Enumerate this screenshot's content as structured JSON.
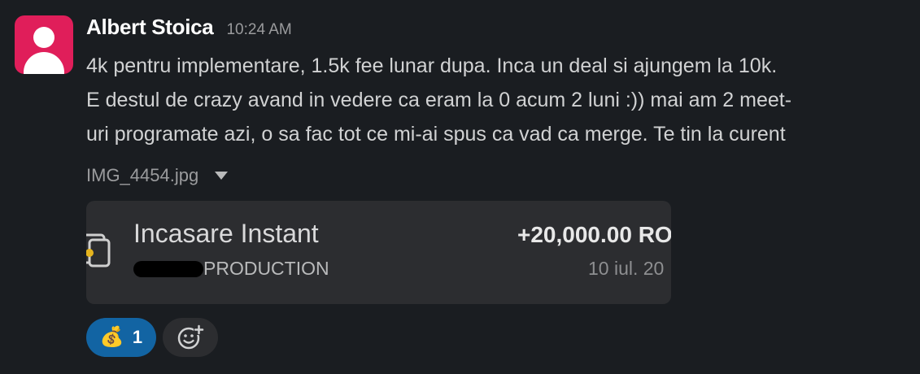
{
  "message": {
    "author": "Albert Stoica",
    "time": "10:24 AM",
    "lines": [
      "4k pentru implementare, 1.5k fee lunar dupa. Inca un deal si ajungem la 10k.",
      "E destul de crazy avand in vedere ca eram la 0 acum 2 luni :)) mai am 2 meet-",
      "uri programate azi, o sa fac tot ce mi-ai spus ca vad ca merge. Te tin la curent"
    ]
  },
  "attachment": {
    "file_name": "IMG_4454.jpg",
    "title": "Incasare Instant",
    "subtitle": "PRODUCTION",
    "amount": "+20,000.00 RO",
    "date": "10 iul. 20"
  },
  "reactions": [
    {
      "emoji": "💰",
      "count": "1"
    }
  ],
  "colors": {
    "background": "#1a1d21",
    "avatar": "#e01e5a",
    "reaction_active": "#1264a3",
    "card": "#2c2d30"
  },
  "icons": {
    "avatar": "default-user-avatar",
    "attachment_toggle": "caret-down-icon",
    "add_reaction": "add-emoji-icon",
    "card": "wallet-icon"
  }
}
